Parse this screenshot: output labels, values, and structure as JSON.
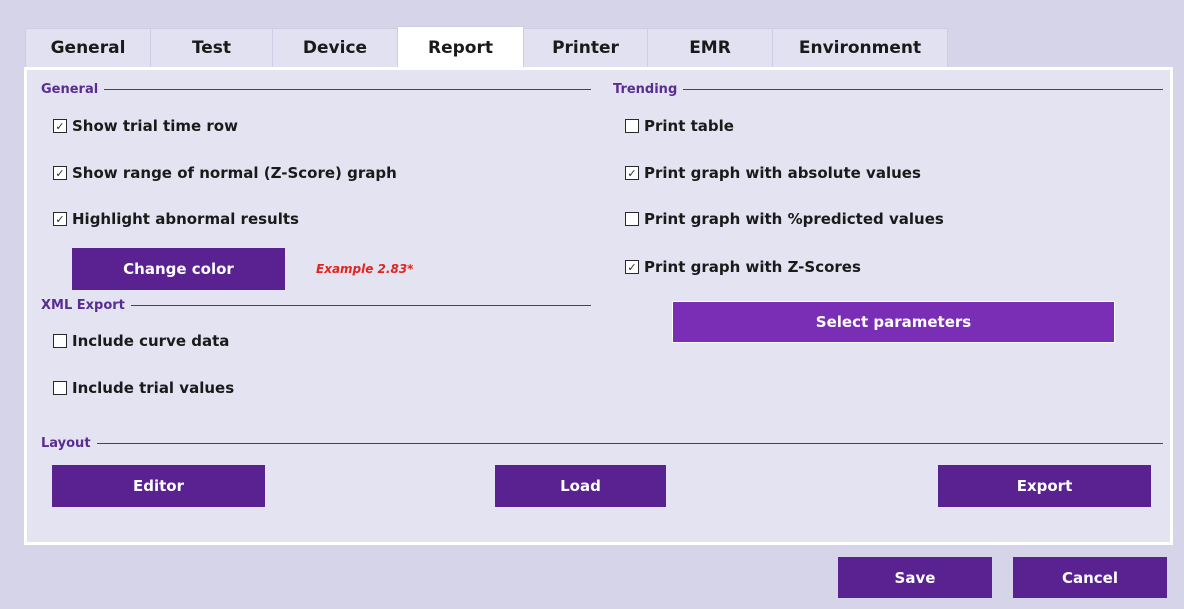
{
  "tabs": [
    {
      "label": "General"
    },
    {
      "label": "Test"
    },
    {
      "label": "Device"
    },
    {
      "label": "Report"
    },
    {
      "label": "Printer"
    },
    {
      "label": "EMR"
    },
    {
      "label": "Environment"
    }
  ],
  "active_tab": "Report",
  "general": {
    "heading": "General",
    "show_trial_time_row": {
      "label": "Show trial time row",
      "checked": true
    },
    "show_range_normal": {
      "label": "Show range of normal (Z-Score) graph",
      "checked": true
    },
    "highlight_abnormal": {
      "label": "Highlight abnormal results",
      "checked": true
    },
    "change_color_label": "Change color",
    "example_text": "Example 2.83*",
    "example_color": "#e2241f"
  },
  "xml_export": {
    "heading": "XML Export",
    "include_curve_data": {
      "label": "Include curve data",
      "checked": false
    },
    "include_trial_values": {
      "label": "Include trial values",
      "checked": false
    }
  },
  "trending": {
    "heading": "Trending",
    "print_table": {
      "label": "Print table",
      "checked": false
    },
    "print_graph_absolute": {
      "label": "Print graph with absolute values",
      "checked": true
    },
    "print_graph_predicted": {
      "label": "Print graph with %predicted values",
      "checked": false
    },
    "print_graph_zscores": {
      "label": "Print graph with Z-Scores",
      "checked": true
    },
    "select_parameters_label": "Select parameters"
  },
  "layout": {
    "heading": "Layout",
    "editor_label": "Editor",
    "load_label": "Load",
    "export_label": "Export"
  },
  "footer": {
    "save_label": "Save",
    "cancel_label": "Cancel"
  },
  "colors": {
    "accent": "#5a2190",
    "accent_bright": "#7a2eb5",
    "heading": "#5a2d91",
    "background": "#d6d4e8",
    "panel": "#e4e3f2"
  },
  "check_glyph": "☑"
}
